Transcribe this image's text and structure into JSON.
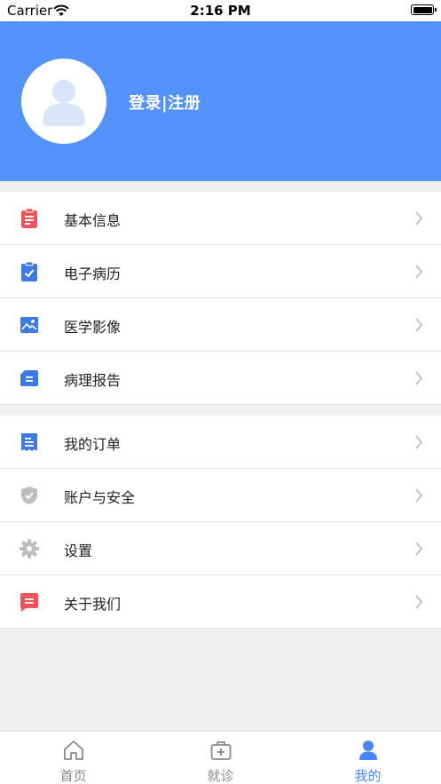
{
  "status_bar": {
    "carrier": "Carrier",
    "time": "2:16 PM"
  },
  "header": {
    "login_label": "登录|注册"
  },
  "menu_group_1": [
    {
      "label": "基本信息",
      "icon": "clipboard-icon",
      "color": "#f0525a"
    },
    {
      "label": "电子病历",
      "icon": "checklist-icon",
      "color": "#3d7ae6"
    },
    {
      "label": "医学影像",
      "icon": "image-icon",
      "color": "#3d7ae6"
    },
    {
      "label": "病理报告",
      "icon": "report-icon",
      "color": "#3d7ae6"
    }
  ],
  "menu_group_2": [
    {
      "label": "我的订单",
      "icon": "receipt-icon",
      "color": "#3d7ae6"
    },
    {
      "label": "账户与安全",
      "icon": "shield-icon",
      "color": "#bdbdbd"
    },
    {
      "label": "设置",
      "icon": "gear-icon",
      "color": "#bdbdbd"
    },
    {
      "label": "关于我们",
      "icon": "message-icon",
      "color": "#f0525a"
    }
  ],
  "tabbar": [
    {
      "label": "首页",
      "icon": "home-icon",
      "active": false
    },
    {
      "label": "就诊",
      "icon": "medical-kit-icon",
      "active": false
    },
    {
      "label": "我的",
      "icon": "user-icon",
      "active": true
    }
  ],
  "colors": {
    "header": "#5392fb",
    "active_tab": "#4a86f7",
    "inactive_tab": "#888888"
  }
}
